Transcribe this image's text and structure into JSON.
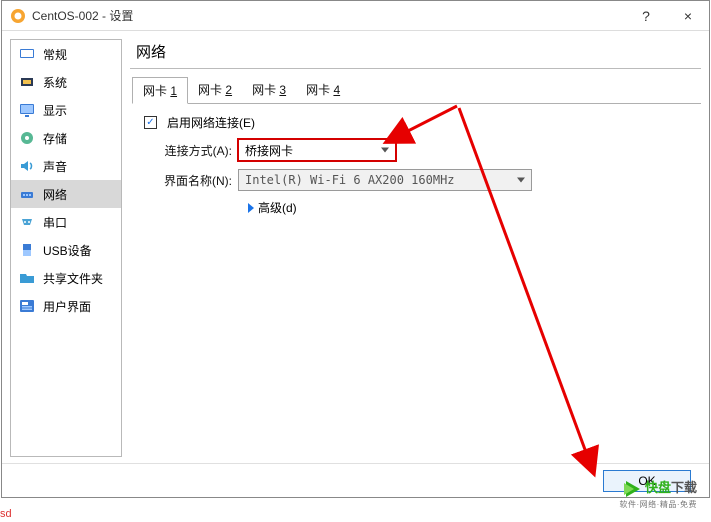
{
  "window": {
    "title": "CentOS-002 - 设置",
    "help": "?",
    "close": "×"
  },
  "sidebar": {
    "items": [
      {
        "label": "常规",
        "icon": "general"
      },
      {
        "label": "系统",
        "icon": "system"
      },
      {
        "label": "显示",
        "icon": "display"
      },
      {
        "label": "存储",
        "icon": "storage"
      },
      {
        "label": "声音",
        "icon": "audio"
      },
      {
        "label": "网络",
        "icon": "network"
      },
      {
        "label": "串口",
        "icon": "serial"
      },
      {
        "label": "USB设备",
        "icon": "usb"
      },
      {
        "label": "共享文件夹",
        "icon": "shared"
      },
      {
        "label": "用户界面",
        "icon": "ui"
      }
    ],
    "selected": 5
  },
  "main": {
    "title": "网络",
    "tabs": [
      {
        "label_prefix": "网卡 ",
        "hotkey": "1"
      },
      {
        "label_prefix": "网卡 ",
        "hotkey": "2"
      },
      {
        "label_prefix": "网卡 ",
        "hotkey": "3"
      },
      {
        "label_prefix": "网卡 ",
        "hotkey": "4"
      }
    ],
    "active_tab": 0,
    "enable_label": "启用网络连接(E)",
    "enable_checked": true,
    "attach_label": "连接方式(A):",
    "attach_value": "桥接网卡",
    "name_label": "界面名称(N):",
    "name_value": "Intel(R) Wi-Fi 6 AX200 160MHz",
    "advanced_label": "高级(d)"
  },
  "footer": {
    "ok": "OK"
  },
  "watermark": {
    "brand1": "快盘",
    "brand2": "下载",
    "sub": "软件·网络·精品·免费"
  },
  "note": "sd",
  "colors": {
    "annotation": "#e60000",
    "select_bg": "#d8d8d8"
  }
}
